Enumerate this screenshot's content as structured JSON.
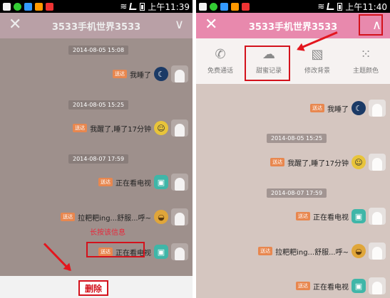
{
  "left": {
    "status_time": "上午11:39",
    "title": "3533手机世界3533",
    "messages": [
      {
        "time": "2014-08-05 15:08",
        "text": "我睡了",
        "tag": "送达",
        "emoji": "moon"
      },
      {
        "time": "2014-08-05 15:25",
        "text": "我醒了,睡了17分钟",
        "tag": "送达",
        "emoji": "smile"
      },
      {
        "time": "2014-08-07 17:59",
        "text": "正在看电视",
        "tag": "送达",
        "emoji": "tv"
      },
      {
        "time": "",
        "text": "拉粑粑ing...舒服...呼~",
        "tag": "送达",
        "emoji": "poop"
      },
      {
        "time": "",
        "text": "正在看电视",
        "tag": "送达",
        "emoji": "tv"
      }
    ],
    "hint": "长按该信息",
    "delete_label": "删除"
  },
  "right": {
    "status_time": "上午11:40",
    "title": "3533手机世界3533",
    "menu": [
      {
        "label": "免费通话",
        "icon": "phone-icon"
      },
      {
        "label": "甜蜜记录",
        "icon": "cloud-sync-icon"
      },
      {
        "label": "修改背景",
        "icon": "image-icon"
      },
      {
        "label": "主题颜色",
        "icon": "grid-icon"
      }
    ],
    "messages": [
      {
        "time": "",
        "text": "我睡了",
        "tag": "送达",
        "emoji": "moon"
      },
      {
        "time": "2014-08-05 15:25",
        "text": "我醒了,睡了17分钟",
        "tag": "送达",
        "emoji": "smile"
      },
      {
        "time": "2014-08-07 17:59",
        "text": "正在看电视",
        "tag": "送达",
        "emoji": "tv"
      },
      {
        "time": "",
        "text": "拉粑粑ing...舒服...呼~",
        "tag": "送达",
        "emoji": "poop"
      },
      {
        "time": "",
        "text": "正在看电视",
        "tag": "送达",
        "emoji": "tv"
      }
    ]
  },
  "colors": {
    "accent_pink": "#e889ad",
    "highlight_red": "#d3121c",
    "tag_orange": "#e8874f"
  }
}
